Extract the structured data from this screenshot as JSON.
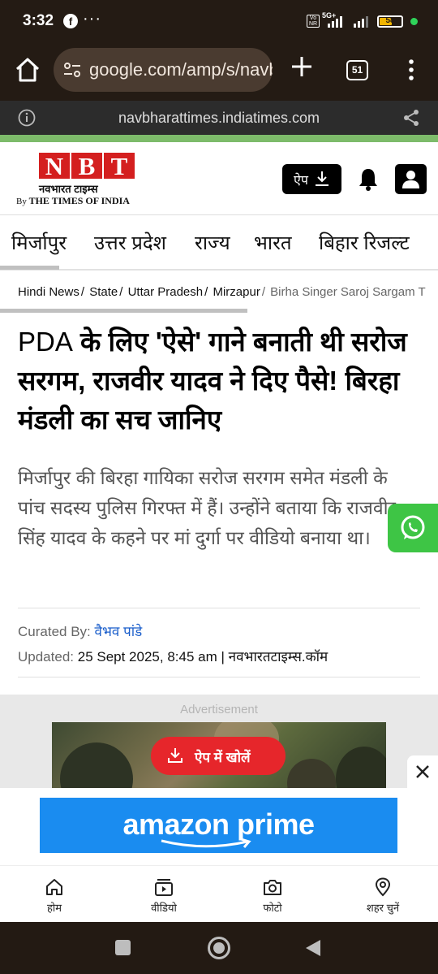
{
  "status_bar": {
    "time": "3:32",
    "facebook_icon": "facebook-icon",
    "more": "···",
    "volte": "Vo NR",
    "network": "5G+",
    "battery": "58",
    "battery_level": 0.58
  },
  "browser": {
    "url": "google.com/amp/s/navbharattimes",
    "tab_count": "51",
    "site_domain": "navbharattimes.indiatimes.com"
  },
  "site": {
    "logo_letters": [
      "N",
      "B",
      "T"
    ],
    "logo_hindi": "नवभारत टाइम्स",
    "logo_by": "By",
    "logo_toi": "THE TIMES OF INDIA",
    "app_button": "ऐप",
    "accent_color": "#d41f1f"
  },
  "categories": [
    "मिर्जापुर",
    "उत्तर प्रदेश",
    "राज्य",
    "भारत",
    "बिहार रिजल्ट"
  ],
  "breadcrumb": [
    "Hindi News",
    "State",
    "Uttar Pradesh",
    "Mirzapur",
    "Birha Singer Saroj Sargam T"
  ],
  "article": {
    "headline_lat": "PDA",
    "headline": " के लिए 'ऐसे' गाने बनाती थी सरोज सरगम, राजवीर यादव ने दिए पैसे! बिरहा मंडली का सच जानिए",
    "summary": "मिर्जापुर की बिरहा गायिका सरोज सरगम समेत मंडली के पांच सदस्य पुलिस गिरफ्त में हैं। उन्होंने बताया कि राजवीर सिंह यादव के कहने पर मां दुर्गा पर वीडियो बनाया था।",
    "curated_label": "Curated By:",
    "curated_author": "वैभव पांडे",
    "updated_label": "Updated:",
    "updated_date": "25 Sept 2025, 8:45 am",
    "updated_source": "| नवभारतटाइम्स.कॉम"
  },
  "ad": {
    "label": "Advertisement",
    "open_app": "ऐप में खोलें",
    "banner_text": "amazon prime",
    "banner_color": "#1a8cf0"
  },
  "bottom_nav": [
    {
      "label": "होम",
      "icon": "home-icon"
    },
    {
      "label": "वीडियो",
      "icon": "video-icon"
    },
    {
      "label": "फोटो",
      "icon": "camera-icon"
    },
    {
      "label": "शहर चुनें",
      "icon": "location-pin-icon"
    }
  ]
}
